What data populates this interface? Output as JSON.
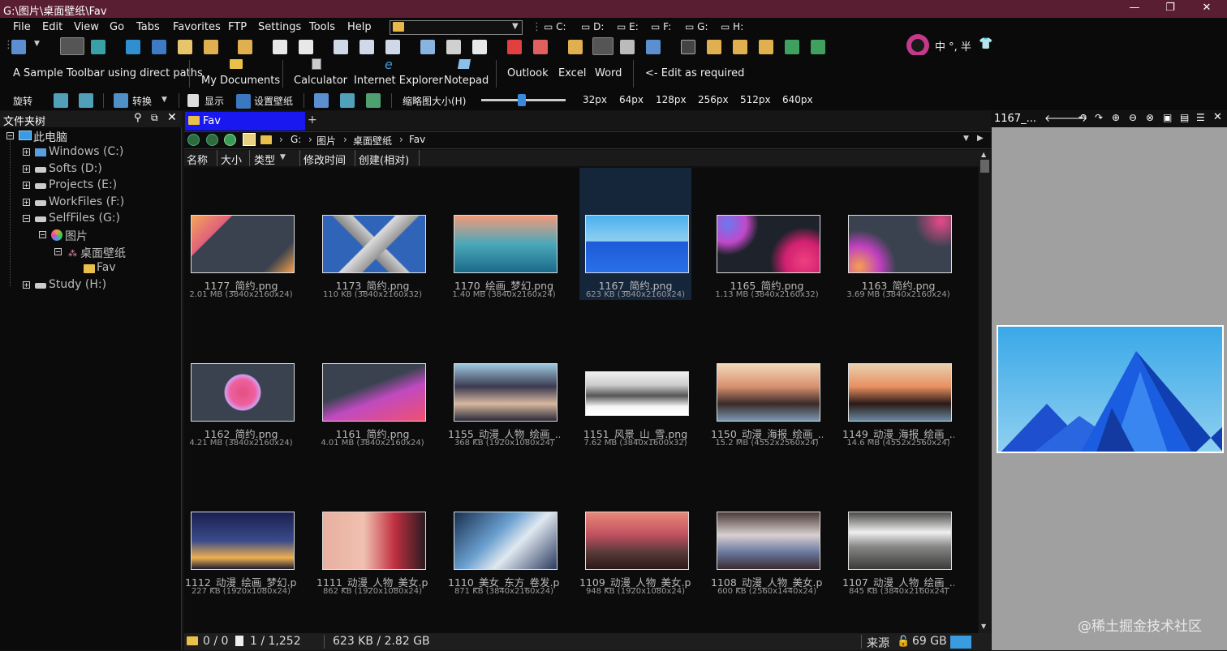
{
  "window": {
    "title": "G:\\图片\\桌面壁纸\\Fav",
    "minimize_glyph": "—",
    "maximize_glyph": "❐",
    "close_glyph": "✕"
  },
  "menu": [
    "File",
    "Edit",
    "View",
    "Go",
    "Tabs",
    "Favorites",
    "FTP",
    "Settings",
    "Tools",
    "Help"
  ],
  "drives": [
    "C:",
    "D:",
    "E:",
    "F:",
    "G:",
    "H:"
  ],
  "ime": {
    "text": "中 °, 半"
  },
  "toolbar_sample": {
    "label": "A Sample Toolbar using direct paths",
    "items": [
      "My Documents",
      "Calculator",
      "Internet Explorer",
      "Notepad",
      "Outlook",
      "Excel",
      "Word",
      "<- Edit as required"
    ]
  },
  "toolbar3": {
    "rotate": "旋转",
    "convert": "转换",
    "show": "显示",
    "wallpaper": "设置壁纸",
    "thumb_size_label": "缩略图大小(H)",
    "slider_level": 0.48,
    "sizes": [
      "32px",
      "64px",
      "128px",
      "256px",
      "512px",
      "640px"
    ]
  },
  "tree": {
    "title": "文件夹树",
    "nodes": [
      "此电脑",
      "Windows (C:)",
      "Softs (D:)",
      "Projects (E:)",
      "WorkFiles (F:)",
      "SelfFiles (G:)",
      "图片",
      "桌面壁纸",
      "Fav",
      "Study (H:)"
    ]
  },
  "tab": {
    "label": "Fav",
    "add": "+"
  },
  "address": {
    "segments": [
      "G:",
      "图片",
      "桌面壁纸",
      "Fav"
    ],
    "sep": "›"
  },
  "columns": [
    "名称",
    "大小",
    "类型",
    "修改时间",
    "创建(相对)"
  ],
  "files": [
    {
      "name": "1177_简约.png",
      "meta": "2.01 MB (3840x2160x24)"
    },
    {
      "name": "1173_简约.png",
      "meta": "110 KB (3840x2160x32)"
    },
    {
      "name": "1170_绘画_梦幻.png",
      "meta": "1.40 MB (3840x2160x24)"
    },
    {
      "name": "1167_简约.png",
      "meta": "623 KB (3840x2160x24)"
    },
    {
      "name": "1165_简约.png",
      "meta": "1.13 MB (3840x2160x32)"
    },
    {
      "name": "1163_简约.png",
      "meta": "3.69 MB (3840x2160x24)"
    },
    {
      "name": "1162_简约.png",
      "meta": "4.21 MB (3840x2160x24)"
    },
    {
      "name": "1161_简约.png",
      "meta": "4.01 MB (3840x2160x24)"
    },
    {
      "name": "1155_动漫_人物_绘画_...",
      "meta": "368 KB (1920x1080x24)"
    },
    {
      "name": "1151_风景_山_雪.png",
      "meta": "7.62 MB (3840x1600x32)"
    },
    {
      "name": "1150_动漫_海报_绘画_...",
      "meta": "15.2 MB (4552x2560x24)"
    },
    {
      "name": "1149_动漫_海报_绘画_...",
      "meta": "14.6 MB (4552x2560x24)"
    },
    {
      "name": "1112_动漫_绘画_梦幻.p...",
      "meta": "227 KB (1920x1080x24)"
    },
    {
      "name": "1111_动漫_人物_美女.p...",
      "meta": "862 KB (1920x1080x24)"
    },
    {
      "name": "1110_美女_东方_卷发.p...",
      "meta": "871 KB (3840x2160x24)"
    },
    {
      "name": "1109_动漫_人物_美女.p...",
      "meta": "948 KB (1920x1080x24)"
    },
    {
      "name": "1108_动漫_人物_美女.p...",
      "meta": "600 KB (2560x1440x24)"
    },
    {
      "name": "1107_动漫_人物_绘画_...",
      "meta": "845 KB (3840x2160x24)"
    }
  ],
  "status": {
    "selection": "0 / 0",
    "files": "1 / 1,252",
    "size": "623 KB / 2.82 GB",
    "source": "来源",
    "free": "69 GB"
  },
  "preview": {
    "title": "1167_..."
  },
  "watermark": "@稀土掘金技术社区"
}
